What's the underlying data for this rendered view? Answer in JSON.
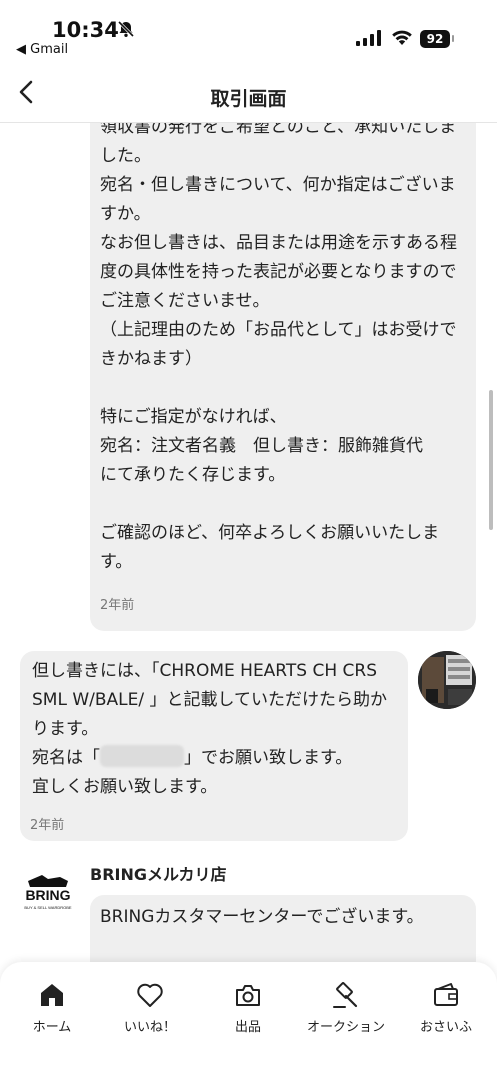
{
  "status_bar": {
    "time": "10:34",
    "back_app": "◀ Gmail",
    "battery": "92"
  },
  "nav": {
    "title": "取引画面"
  },
  "messages": [
    {
      "text": "領収書の発行をご希望とのこと、承知いたしました。\n宛名・但し書きについて、何か指定はございますか。\nなお但し書きは、品目または用途を示すある程度の具体性を持った表記が必要となりますのでご注意くださいませ。\n（上記理由のため「お品代として」はお受けできかねます）\n\n特にご指定がなければ、\n宛名：注文者名義　但し書き：服飾雑貨代\nにて承りたく存じます。\n\nご確認のほど、何卒よろしくお願いいたします。",
      "time": "2年前"
    },
    {
      "line1": "但し書きには、「CHROME HEARTS CH CRS SML W/BALE/ 」と記載していただけたら助かります。",
      "line2_pre": "宛名は「",
      "line2_post": "」でお願い致します。",
      "line3": "宜しくお願い致します。",
      "time": "2年前"
    },
    {
      "sender": "BRINGメルカリ店",
      "logo_text": "BRING",
      "logo_subtext": "BUY & SELL WARDROBE",
      "text": "BRINGカスタマーセンターでございます。"
    }
  ],
  "tabbar": {
    "items": [
      {
        "label": "ホーム",
        "icon": "home-icon"
      },
      {
        "label": "いいね！",
        "icon": "heart-icon"
      },
      {
        "label": "出品",
        "icon": "camera-icon"
      },
      {
        "label": "オークション",
        "icon": "gavel-icon"
      },
      {
        "label": "おさいふ",
        "icon": "wallet-icon"
      }
    ]
  }
}
